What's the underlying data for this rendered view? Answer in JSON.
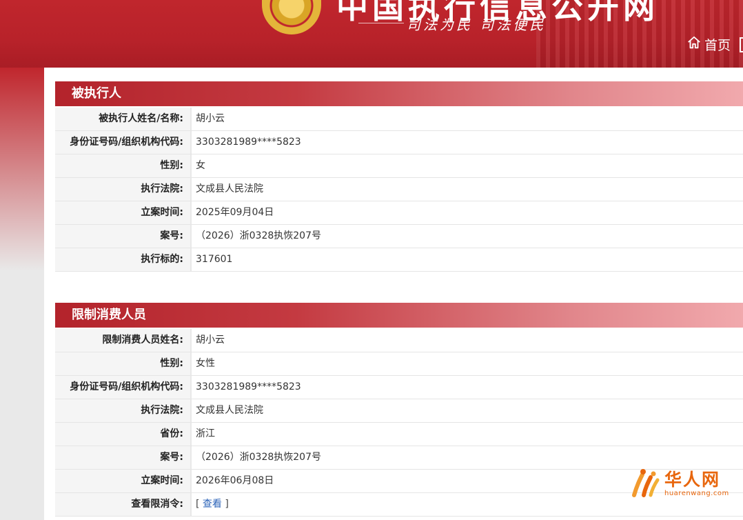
{
  "header": {
    "site_title": "中国执行信息公开网",
    "slogan": "司法为民  司法便民",
    "nav_home": "首页"
  },
  "section1": {
    "title": "被执行人",
    "rows": [
      {
        "label": "被执行人姓名/名称:",
        "value": "胡小云"
      },
      {
        "label": "身份证号码/组织机构代码:",
        "value": "3303281989****5823"
      },
      {
        "label": "性别:",
        "value": "女"
      },
      {
        "label": "执行法院:",
        "value": "文成县人民法院"
      },
      {
        "label": "立案时间:",
        "value": "2025年09月04日"
      },
      {
        "label": "案号:",
        "value": "（2026）浙0328执恢207号"
      },
      {
        "label": "执行标的:",
        "value": "317601"
      }
    ]
  },
  "section2": {
    "title": "限制消费人员",
    "rows": [
      {
        "label": "限制消费人员姓名:",
        "value": "胡小云"
      },
      {
        "label": "性别:",
        "value": "女性"
      },
      {
        "label": "身份证号码/组织机构代码:",
        "value": "3303281989****5823"
      },
      {
        "label": "执行法院:",
        "value": "文成县人民法院"
      },
      {
        "label": "省份:",
        "value": "浙江"
      },
      {
        "label": "案号:",
        "value": "（2026）浙0328执恢207号"
      },
      {
        "label": "立案时间:",
        "value": "2026年06月08日"
      },
      {
        "label": "查看限消令:",
        "value": "查看",
        "bracket_open": "[",
        "bracket_close": "]"
      }
    ]
  },
  "watermark": {
    "main": "华人网",
    "sub": "huarenwang.com"
  },
  "colors": {
    "brand_red": "#c0262d",
    "link_blue": "#2a62b8",
    "watermark_orange": "#e8660d"
  }
}
